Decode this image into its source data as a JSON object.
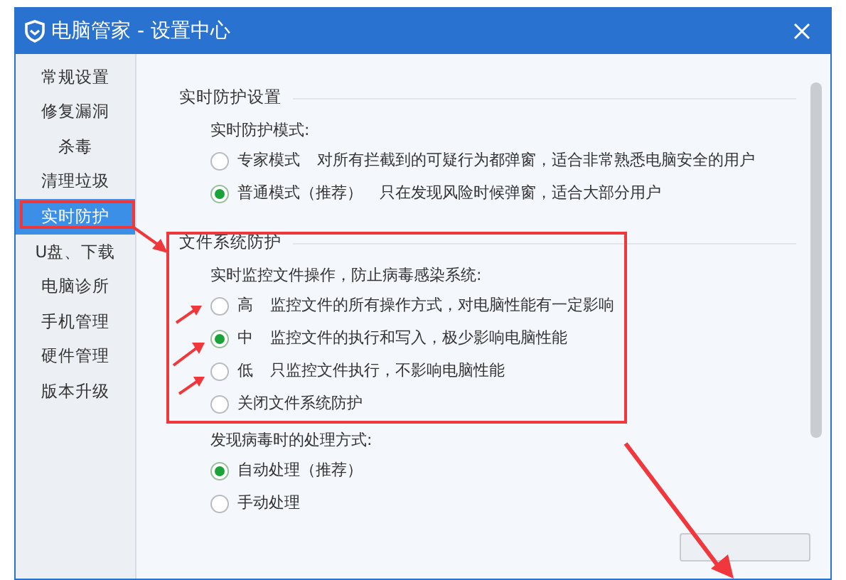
{
  "window": {
    "title": "电脑管家 - 设置中心"
  },
  "sidebar": {
    "items": [
      {
        "label": "常规设置",
        "selected": false
      },
      {
        "label": "修复漏洞",
        "selected": false
      },
      {
        "label": "杀毒",
        "selected": false
      },
      {
        "label": "清理垃圾",
        "selected": false
      },
      {
        "label": "实时防护",
        "selected": true
      },
      {
        "label": "U盘、下载",
        "selected": false
      },
      {
        "label": "电脑诊所",
        "selected": false
      },
      {
        "label": "手机管理",
        "selected": false
      },
      {
        "label": "硬件管理",
        "selected": false
      },
      {
        "label": "版本升级",
        "selected": false
      }
    ]
  },
  "sections": [
    {
      "title": "实时防护设置",
      "groups": [
        {
          "label": "实时防护模式:",
          "options": [
            {
              "label": "专家模式",
              "description": "对所有拦截到的可疑行为都弹窗，适合非常熟悉电脑安全的用户",
              "selected": false
            },
            {
              "label": "普通模式（推荐）",
              "description": "只在发现风险时候弹窗，适合大部分用户",
              "selected": true
            }
          ]
        }
      ]
    },
    {
      "title": "文件系统防护",
      "groups": [
        {
          "label": "实时监控文件操作，防止病毒感染系统:",
          "options": [
            {
              "label": "高",
              "description": "监控文件的所有操作方式，对电脑性能有一定影响",
              "selected": false
            },
            {
              "label": "中",
              "description": "监控文件的执行和写入，极少影响电脑性能",
              "selected": true
            },
            {
              "label": "低",
              "description": "只监控文件执行，不影响电脑性能",
              "selected": false
            },
            {
              "label": "关闭文件系统防护",
              "selected": false
            }
          ]
        },
        {
          "label": "发现病毒时的处理方式:",
          "options": [
            {
              "label": "自动处理（推荐）",
              "selected": true
            },
            {
              "label": "手动处理",
              "selected": false
            }
          ]
        }
      ]
    }
  ]
}
